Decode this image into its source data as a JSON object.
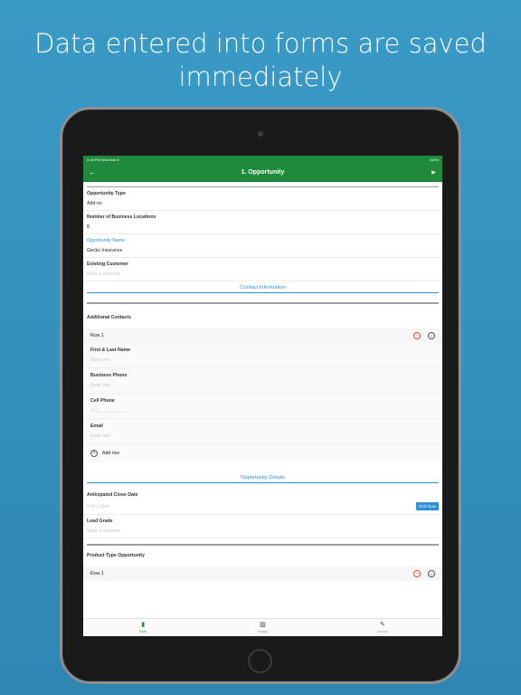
{
  "headline": {
    "line1": "Data entered into forms are saved",
    "line2": "immediately"
  },
  "status": {
    "time": "2:33 PM   Wed Mar 8",
    "battery": "100%"
  },
  "nav": {
    "title": "1. Opportunity",
    "back_icon": "←",
    "send_icon": "➤"
  },
  "fields": {
    "opportunity_type": {
      "label": "Opportunity Type",
      "value": "Add-on"
    },
    "business_locations": {
      "label": "Number of Business Locations",
      "value": "8"
    },
    "opportunity_name": {
      "label": "Opportunity Name",
      "value": "Gecko Insurance"
    },
    "existing_customer": {
      "label": "Existing Customer",
      "placeholder": "Make a selection"
    }
  },
  "section_contact": "Contact Information",
  "additional_contacts": {
    "label": "Additional Contacts",
    "row_title": "Row 1",
    "remove_icon": "−",
    "collapse_icon": "⌄",
    "first_last": {
      "label": "First & Last Name",
      "placeholder": "Enter text"
    },
    "business_phone": {
      "label": "Business Phone",
      "placeholder": "Enter text"
    },
    "cell_phone": {
      "label": "Cell Phone",
      "placeholder": "+1 (___) ___-____"
    },
    "email": {
      "label": "Email",
      "placeholder": "Enter text"
    },
    "add_row": "Add row",
    "add_icon": "+"
  },
  "section_details": "Opportunity Details",
  "close_date": {
    "label": "Anticipated Close Date",
    "placeholder": "Pick a date",
    "button": "Pick Now"
  },
  "lead_grade": {
    "label": "Lead Grade",
    "placeholder": "Make a selection"
  },
  "product_type": {
    "label": "Product Type Opportunity",
    "row_title": "Row 1",
    "remove_icon": "−",
    "collapse_icon": "⌄"
  },
  "tabs": [
    {
      "label": "Form",
      "icon": "▮"
    },
    {
      "label": "Images",
      "icon": "▨"
    },
    {
      "label": "Actions",
      "icon": "✎"
    }
  ],
  "colors": {
    "brand": "#1f8a3b",
    "accent": "#2f8fd3",
    "remove": "#e04848"
  }
}
